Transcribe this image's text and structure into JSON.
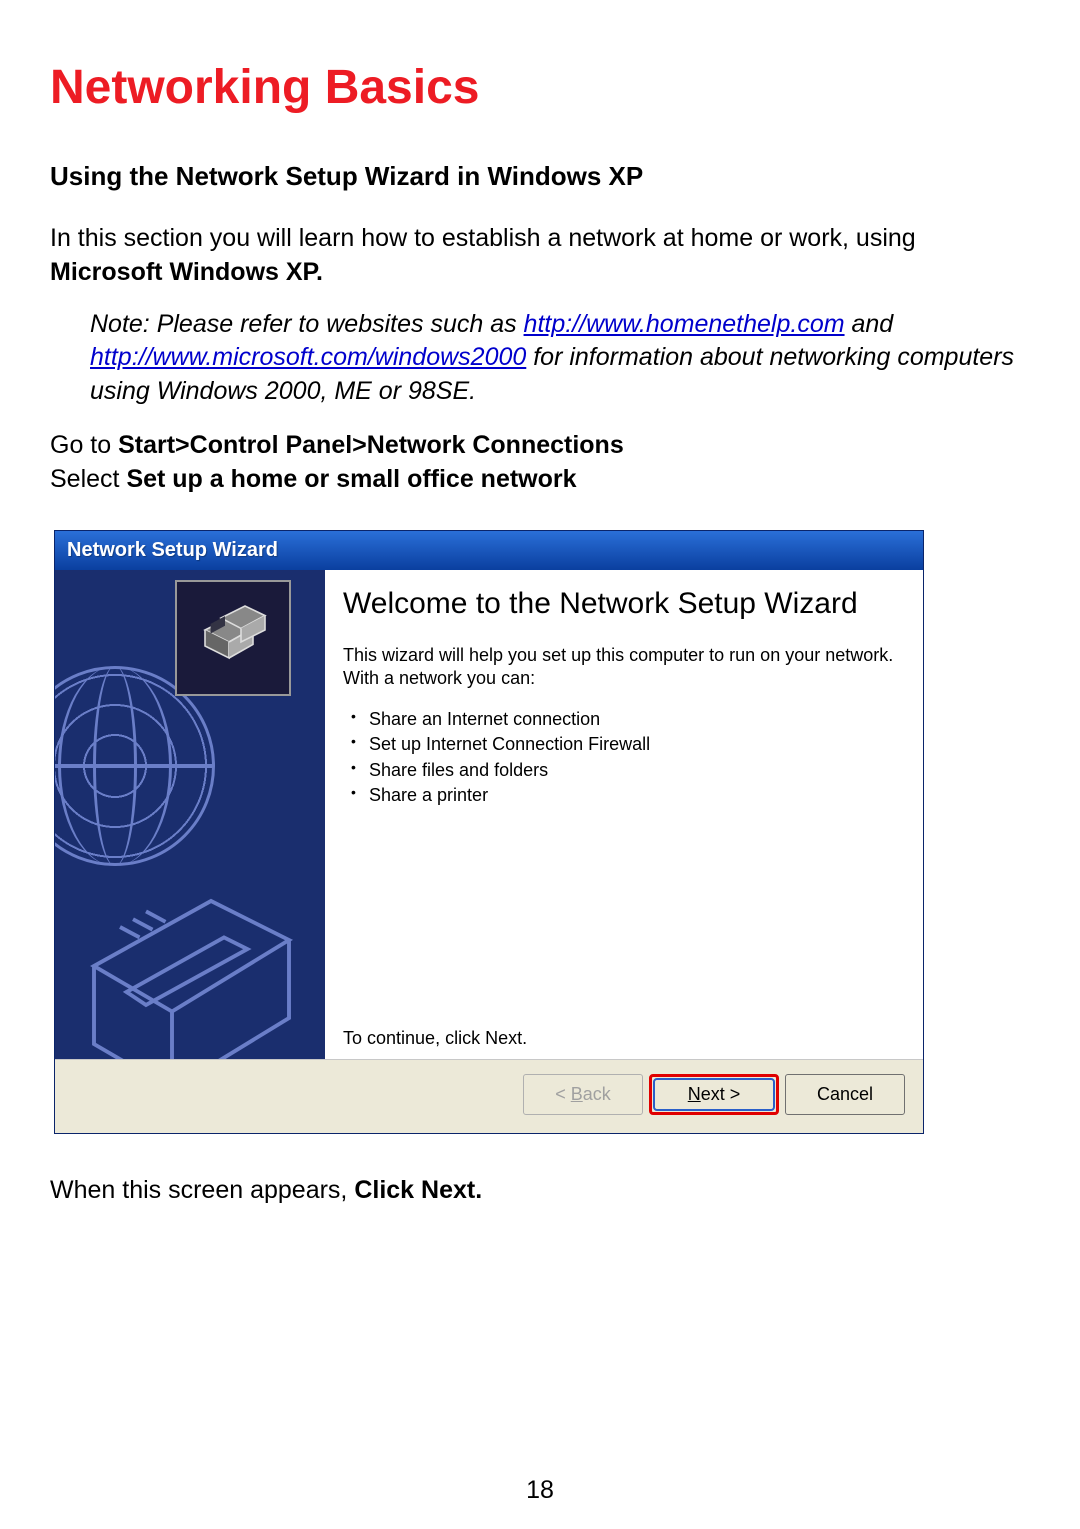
{
  "document": {
    "title": "Networking Basics",
    "section_heading": "Using the Network Setup Wizard in Windows XP",
    "intro_text_before_bold": "In this section you will learn how to establish a network at home or work, using ",
    "intro_bold": "Microsoft Windows XP.",
    "note_prefix": "Note:  Please refer to websites such as ",
    "note_link1": "http://www.homenethelp.com",
    "note_mid1": " and ",
    "note_link2": "http://www.microsoft.com/windows2000",
    "note_tail": "  for information about networking computers using Windows 2000, ME or 98SE.",
    "step1_pre": "Go to ",
    "step1_bold": "Start>Control Panel>Network Connections",
    "step2_pre": "Select ",
    "step2_bold": "Set up a home or small office network",
    "after_pre": "When this screen appears, ",
    "after_bold": "Click Next.",
    "page_number": "18"
  },
  "wizard": {
    "title": "Network Setup Wizard",
    "headline": "Welcome to the Network Setup Wizard",
    "description": "This wizard will help you set up this computer to run on your network. With a network you can:",
    "bullets": [
      "Share an Internet connection",
      "Set up Internet Connection Firewall",
      "Share files and folders",
      "Share a printer"
    ],
    "continue_text": "To continue, click Next.",
    "buttons": {
      "back_lt": "< ",
      "back_u": "B",
      "back_rest": "ack",
      "next_u": "N",
      "next_rest": "ext >",
      "cancel": "Cancel"
    }
  }
}
